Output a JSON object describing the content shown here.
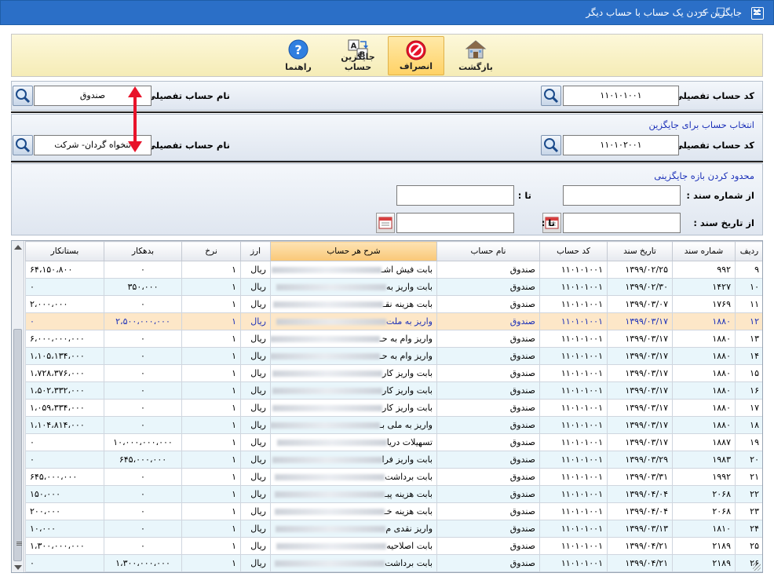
{
  "window": {
    "title": "جایگزین کردن یک حساب با حساب دیگر",
    "min": "—",
    "max": "☐",
    "close": "✕"
  },
  "toolbar": {
    "back_label": "بازگشت",
    "cancel_label": "انصراف",
    "replace_label": "جایگزین حساب",
    "help_label": "راهنما"
  },
  "source": {
    "code_label": "کد حساب تفصیلی :",
    "code_value": "۱۱۰۱۰۱۰۰۱",
    "name_label": "نام حساب تفصیلی :",
    "name_value": "صندوق"
  },
  "target": {
    "section_title": "انتخاب حساب برای جایگزین",
    "code_label": "کد حساب تفصیلی :",
    "code_value": "۱۱۰۱۰۲۰۰۱",
    "name_label": "نام حساب تفصیلی :",
    "name_value": "تنخواه گردان- شرکت"
  },
  "range": {
    "section_title": "محدود کردن بازه جایگزینی",
    "from_doc_label": "از شماره سند :",
    "to_doc_label": "تا :",
    "from_date_label": "از تاریخ سند :",
    "to_date_label": "تا :"
  },
  "grid": {
    "columns": [
      "ردیف",
      "شماره سند",
      "تاریخ سند",
      "کد حساب",
      "نام حساب",
      "شرح هر حساب",
      "ارز",
      "نرخ",
      "بدهکار",
      "بستانکار"
    ],
    "rows": [
      [
        "۹",
        "۹۹۲",
        "۱۳۹۹/۰۲/۲۵",
        "۱۱۰۱۰۱۰۰۱",
        "صندوق",
        "بابت فیش اشـ",
        "ریال",
        "۱",
        "۰",
        "۶۴،۱۵۰،۸۰۰"
      ],
      [
        "۱۰",
        "۱۴۲۷",
        "۱۳۹۹/۰۲/۳۰",
        "۱۱۰۱۰۱۰۰۱",
        "صندوق",
        "بابت واریز به",
        "ریال",
        "۱",
        "۳۵۰،۰۰۰",
        "۰"
      ],
      [
        "۱۱",
        "۱۷۶۹",
        "۱۳۹۹/۰۳/۰۷",
        "۱۱۰۱۰۱۰۰۱",
        "صندوق",
        "بابت هزینه نقـ",
        "ریال",
        "۱",
        "۰",
        "۲،۰۰۰،۰۰۰"
      ],
      [
        "۱۲",
        "۱۸۸۰",
        "۱۳۹۹/۰۳/۱۷",
        "۱۱۰۱۰۱۰۰۱",
        "صندوق",
        "واریز به ملت",
        "ریال",
        "۱",
        "۲،۵۰۰،۰۰۰،۰۰۰",
        "۰"
      ],
      [
        "۱۳",
        "۱۸۸۰",
        "۱۳۹۹/۰۳/۱۷",
        "۱۱۰۱۰۱۰۰۱",
        "صندوق",
        "واریز وام به حـ",
        "ریال",
        "۱",
        "۰",
        "۶،۰۰۰،۰۰۰،۰۰۰"
      ],
      [
        "۱۴",
        "۱۸۸۰",
        "۱۳۹۹/۰۳/۱۷",
        "۱۱۰۱۰۱۰۰۱",
        "صندوق",
        "واریز وام به حـ",
        "ریال",
        "۱",
        "۰",
        "۱،۱۰۵،۱۳۴،۰۰۰"
      ],
      [
        "۱۵",
        "۱۸۸۰",
        "۱۳۹۹/۰۳/۱۷",
        "۱۱۰۱۰۱۰۰۱",
        "صندوق",
        "بابت واریز کار",
        "ریال",
        "۱",
        "۰",
        "۱،۷۲۸،۳۷۶،۰۰۰"
      ],
      [
        "۱۶",
        "۱۸۸۰",
        "۱۳۹۹/۰۳/۱۷",
        "۱۱۰۱۰۱۰۰۱",
        "صندوق",
        "بابت واریز کار",
        "ریال",
        "۱",
        "۰",
        "۱،۵۰۲،۳۳۲،۰۰۰"
      ],
      [
        "۱۷",
        "۱۸۸۰",
        "۱۳۹۹/۰۳/۱۷",
        "۱۱۰۱۰۱۰۰۱",
        "صندوق",
        "بابت واریز کار",
        "ریال",
        "۱",
        "۰",
        "۱،۰۵۹،۳۳۴،۰۰۰"
      ],
      [
        "۱۸",
        "۱۸۸۰",
        "۱۳۹۹/۰۳/۱۷",
        "۱۱۰۱۰۱۰۰۱",
        "صندوق",
        "واریز به ملی بـ",
        "ریال",
        "۱",
        "۰",
        "۱،۱۰۴،۸۱۴،۰۰۰"
      ],
      [
        "۱۹",
        "۱۸۸۷",
        "۱۳۹۹/۰۳/۱۷",
        "۱۱۰۱۰۱۰۰۱",
        "صندوق",
        "تسهیلات دریا",
        "ریال",
        "۱",
        "۱۰،۰۰۰،۰۰۰،۰۰۰",
        "۰"
      ],
      [
        "۲۰",
        "۱۹۸۳",
        "۱۳۹۹/۰۳/۲۹",
        "۱۱۰۱۰۱۰۰۱",
        "صندوق",
        "بابت واریز فرا",
        "ریال",
        "۱",
        "۶۴۵،۰۰۰،۰۰۰",
        "۰"
      ],
      [
        "۲۱",
        "۱۹۹۲",
        "۱۳۹۹/۰۳/۳۱",
        "۱۱۰۱۰۱۰۰۱",
        "صندوق",
        "بابت برداشت",
        "ریال",
        "۱",
        "۰",
        "۶۴۵،۰۰۰،۰۰۰"
      ],
      [
        "۲۲",
        "۲۰۶۸",
        "۱۳۹۹/۰۴/۰۴",
        "۱۱۰۱۰۱۰۰۱",
        "صندوق",
        "بابت هزینه پیـ",
        "ریال",
        "۱",
        "۰",
        "۱۵۰،۰۰۰"
      ],
      [
        "۲۳",
        "۲۰۶۸",
        "۱۳۹۹/۰۴/۰۴",
        "۱۱۰۱۰۱۰۰۱",
        "صندوق",
        "بابت هزینه خـ",
        "ریال",
        "۱",
        "۰",
        "۲۰۰،۰۰۰"
      ],
      [
        "۲۴",
        "۱۸۱۰",
        "۱۳۹۹/۰۳/۱۳",
        "۱۱۰۱۰۱۰۰۱",
        "صندوق",
        "واریز نقدی م",
        "ریال",
        "۱",
        "۰",
        "۱۰،۰۰۰"
      ],
      [
        "۲۵",
        "۲۱۸۹",
        "۱۳۹۹/۰۴/۲۱",
        "۱۱۰۱۰۱۰۰۱",
        "صندوق",
        "بابت اصلاحیه",
        "ریال",
        "۱",
        "۰",
        "۱،۳۰۰،۰۰۰،۰۰۰"
      ],
      [
        "۲۶",
        "۲۱۸۹",
        "۱۳۹۹/۰۴/۲۱",
        "۱۱۰۱۰۱۰۰۱",
        "صندوق",
        "بابت برداشت",
        "ریال",
        "۱",
        "۱،۳۰۰،۰۰۰،۰۰۰",
        "۰"
      ]
    ],
    "selected_row": 3,
    "highlight_column": "شرح هر حساب"
  },
  "colors": {
    "titlebar": "#2b6fc7",
    "accent_text": "#1a2fb8",
    "selected_row": "#fde7c8",
    "arrow": "#e8132a"
  }
}
